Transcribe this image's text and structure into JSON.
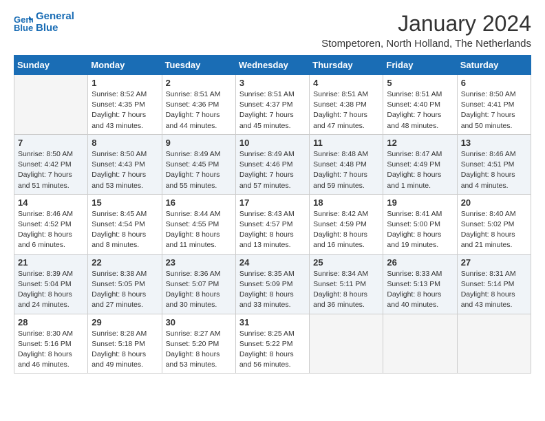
{
  "logo": {
    "line1": "General",
    "line2": "Blue"
  },
  "title": "January 2024",
  "location": "Stompetoren, North Holland, The Netherlands",
  "days_of_week": [
    "Sunday",
    "Monday",
    "Tuesday",
    "Wednesday",
    "Thursday",
    "Friday",
    "Saturday"
  ],
  "weeks": [
    [
      {
        "day": "",
        "sunrise": "",
        "sunset": "",
        "daylight": ""
      },
      {
        "day": "1",
        "sunrise": "Sunrise: 8:52 AM",
        "sunset": "Sunset: 4:35 PM",
        "daylight": "Daylight: 7 hours and 43 minutes."
      },
      {
        "day": "2",
        "sunrise": "Sunrise: 8:51 AM",
        "sunset": "Sunset: 4:36 PM",
        "daylight": "Daylight: 7 hours and 44 minutes."
      },
      {
        "day": "3",
        "sunrise": "Sunrise: 8:51 AM",
        "sunset": "Sunset: 4:37 PM",
        "daylight": "Daylight: 7 hours and 45 minutes."
      },
      {
        "day": "4",
        "sunrise": "Sunrise: 8:51 AM",
        "sunset": "Sunset: 4:38 PM",
        "daylight": "Daylight: 7 hours and 47 minutes."
      },
      {
        "day": "5",
        "sunrise": "Sunrise: 8:51 AM",
        "sunset": "Sunset: 4:40 PM",
        "daylight": "Daylight: 7 hours and 48 minutes."
      },
      {
        "day": "6",
        "sunrise": "Sunrise: 8:50 AM",
        "sunset": "Sunset: 4:41 PM",
        "daylight": "Daylight: 7 hours and 50 minutes."
      }
    ],
    [
      {
        "day": "7",
        "sunrise": "Sunrise: 8:50 AM",
        "sunset": "Sunset: 4:42 PM",
        "daylight": "Daylight: 7 hours and 51 minutes."
      },
      {
        "day": "8",
        "sunrise": "Sunrise: 8:50 AM",
        "sunset": "Sunset: 4:43 PM",
        "daylight": "Daylight: 7 hours and 53 minutes."
      },
      {
        "day": "9",
        "sunrise": "Sunrise: 8:49 AM",
        "sunset": "Sunset: 4:45 PM",
        "daylight": "Daylight: 7 hours and 55 minutes."
      },
      {
        "day": "10",
        "sunrise": "Sunrise: 8:49 AM",
        "sunset": "Sunset: 4:46 PM",
        "daylight": "Daylight: 7 hours and 57 minutes."
      },
      {
        "day": "11",
        "sunrise": "Sunrise: 8:48 AM",
        "sunset": "Sunset: 4:48 PM",
        "daylight": "Daylight: 7 hours and 59 minutes."
      },
      {
        "day": "12",
        "sunrise": "Sunrise: 8:47 AM",
        "sunset": "Sunset: 4:49 PM",
        "daylight": "Daylight: 8 hours and 1 minute."
      },
      {
        "day": "13",
        "sunrise": "Sunrise: 8:46 AM",
        "sunset": "Sunset: 4:51 PM",
        "daylight": "Daylight: 8 hours and 4 minutes."
      }
    ],
    [
      {
        "day": "14",
        "sunrise": "Sunrise: 8:46 AM",
        "sunset": "Sunset: 4:52 PM",
        "daylight": "Daylight: 8 hours and 6 minutes."
      },
      {
        "day": "15",
        "sunrise": "Sunrise: 8:45 AM",
        "sunset": "Sunset: 4:54 PM",
        "daylight": "Daylight: 8 hours and 8 minutes."
      },
      {
        "day": "16",
        "sunrise": "Sunrise: 8:44 AM",
        "sunset": "Sunset: 4:55 PM",
        "daylight": "Daylight: 8 hours and 11 minutes."
      },
      {
        "day": "17",
        "sunrise": "Sunrise: 8:43 AM",
        "sunset": "Sunset: 4:57 PM",
        "daylight": "Daylight: 8 hours and 13 minutes."
      },
      {
        "day": "18",
        "sunrise": "Sunrise: 8:42 AM",
        "sunset": "Sunset: 4:59 PM",
        "daylight": "Daylight: 8 hours and 16 minutes."
      },
      {
        "day": "19",
        "sunrise": "Sunrise: 8:41 AM",
        "sunset": "Sunset: 5:00 PM",
        "daylight": "Daylight: 8 hours and 19 minutes."
      },
      {
        "day": "20",
        "sunrise": "Sunrise: 8:40 AM",
        "sunset": "Sunset: 5:02 PM",
        "daylight": "Daylight: 8 hours and 21 minutes."
      }
    ],
    [
      {
        "day": "21",
        "sunrise": "Sunrise: 8:39 AM",
        "sunset": "Sunset: 5:04 PM",
        "daylight": "Daylight: 8 hours and 24 minutes."
      },
      {
        "day": "22",
        "sunrise": "Sunrise: 8:38 AM",
        "sunset": "Sunset: 5:05 PM",
        "daylight": "Daylight: 8 hours and 27 minutes."
      },
      {
        "day": "23",
        "sunrise": "Sunrise: 8:36 AM",
        "sunset": "Sunset: 5:07 PM",
        "daylight": "Daylight: 8 hours and 30 minutes."
      },
      {
        "day": "24",
        "sunrise": "Sunrise: 8:35 AM",
        "sunset": "Sunset: 5:09 PM",
        "daylight": "Daylight: 8 hours and 33 minutes."
      },
      {
        "day": "25",
        "sunrise": "Sunrise: 8:34 AM",
        "sunset": "Sunset: 5:11 PM",
        "daylight": "Daylight: 8 hours and 36 minutes."
      },
      {
        "day": "26",
        "sunrise": "Sunrise: 8:33 AM",
        "sunset": "Sunset: 5:13 PM",
        "daylight": "Daylight: 8 hours and 40 minutes."
      },
      {
        "day": "27",
        "sunrise": "Sunrise: 8:31 AM",
        "sunset": "Sunset: 5:14 PM",
        "daylight": "Daylight: 8 hours and 43 minutes."
      }
    ],
    [
      {
        "day": "28",
        "sunrise": "Sunrise: 8:30 AM",
        "sunset": "Sunset: 5:16 PM",
        "daylight": "Daylight: 8 hours and 46 minutes."
      },
      {
        "day": "29",
        "sunrise": "Sunrise: 8:28 AM",
        "sunset": "Sunset: 5:18 PM",
        "daylight": "Daylight: 8 hours and 49 minutes."
      },
      {
        "day": "30",
        "sunrise": "Sunrise: 8:27 AM",
        "sunset": "Sunset: 5:20 PM",
        "daylight": "Daylight: 8 hours and 53 minutes."
      },
      {
        "day": "31",
        "sunrise": "Sunrise: 8:25 AM",
        "sunset": "Sunset: 5:22 PM",
        "daylight": "Daylight: 8 hours and 56 minutes."
      },
      {
        "day": "",
        "sunrise": "",
        "sunset": "",
        "daylight": ""
      },
      {
        "day": "",
        "sunrise": "",
        "sunset": "",
        "daylight": ""
      },
      {
        "day": "",
        "sunrise": "",
        "sunset": "",
        "daylight": ""
      }
    ]
  ]
}
